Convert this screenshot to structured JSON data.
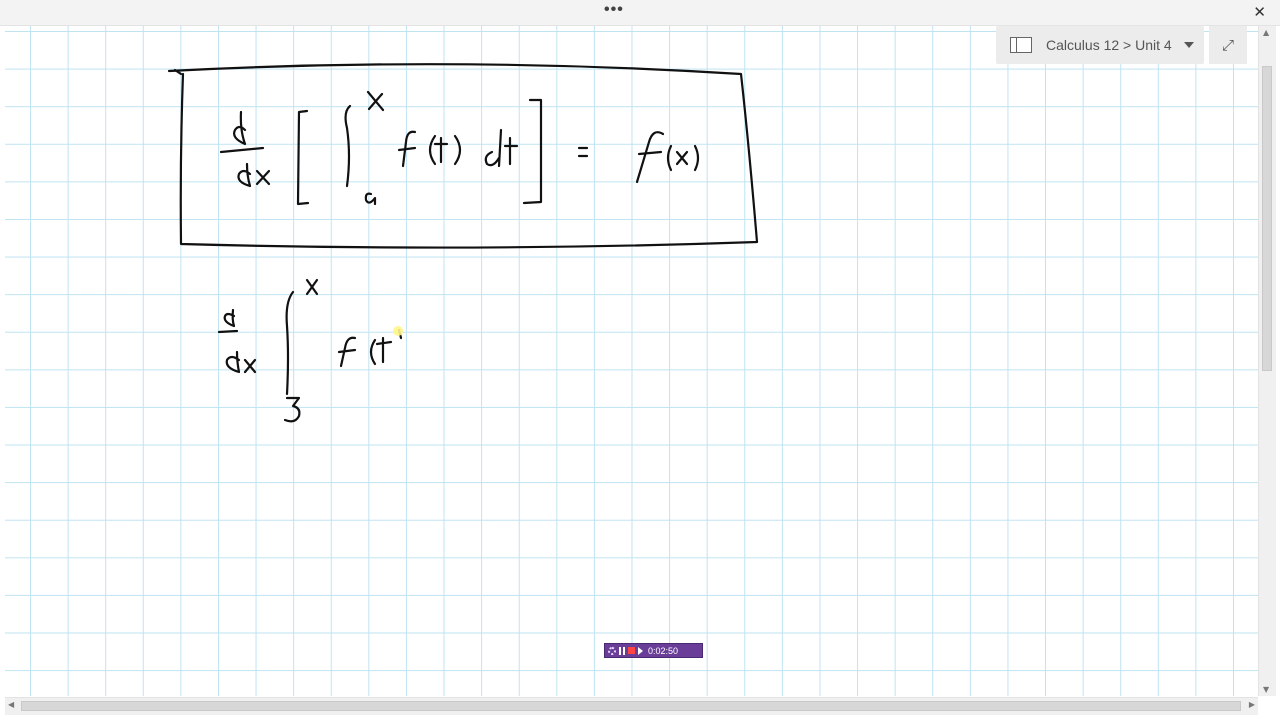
{
  "titlebar": {
    "more_label": "•••",
    "close_label": "✕"
  },
  "notebook": {
    "breadcrumb": "Calculus 12 > Unit 4",
    "expand_label": "⤢"
  },
  "recorder": {
    "time": "0:02:50"
  },
  "scrollbars": {
    "up": "▲",
    "down": "▼",
    "left": "◀",
    "right": "▶"
  }
}
